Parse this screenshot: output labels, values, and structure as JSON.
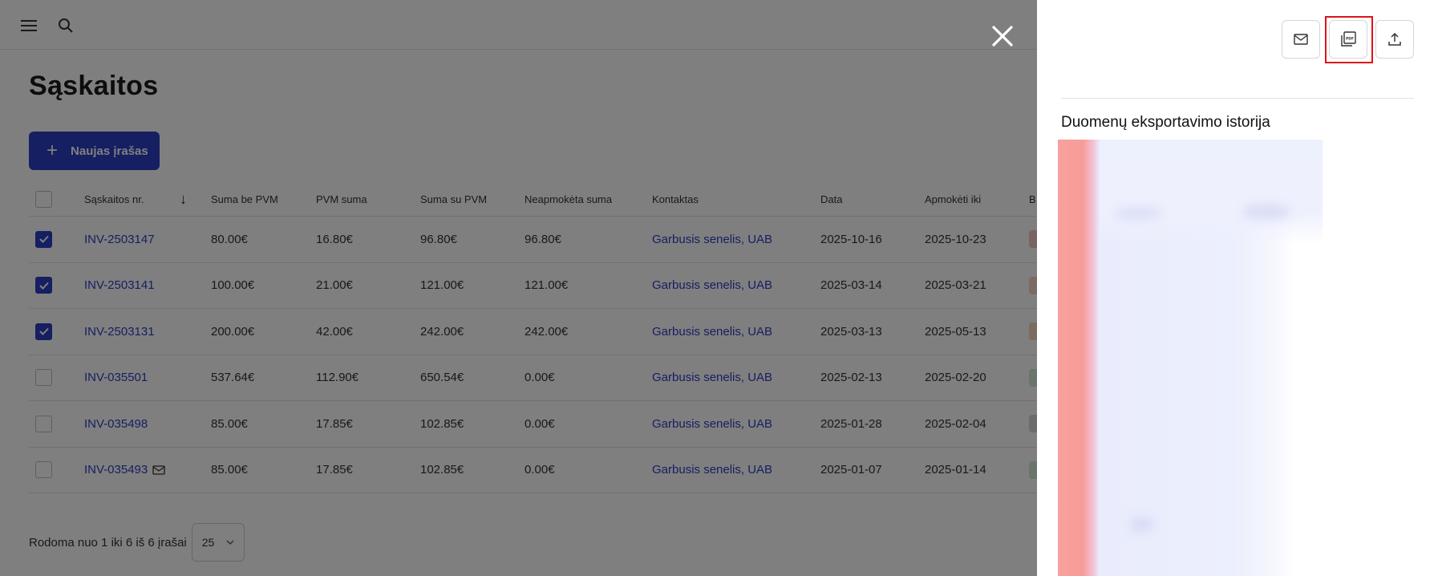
{
  "topbar": {
    "menu_icon": "hamburger-menu-icon",
    "search_icon": "search-icon"
  },
  "page": {
    "title": "Sąskaitos",
    "new_button_label": "Naujas įrašas"
  },
  "table": {
    "columns": {
      "invoice_nr": "Sąskaitos nr.",
      "sum_without_vat": "Suma be PVM",
      "vat_sum": "PVM suma",
      "sum_with_vat": "Suma su PVM",
      "unpaid_sum": "Neapmokėta suma",
      "contact": "Kontaktas",
      "date": "Data",
      "due": "Apmokėti iki",
      "status_partial": "B"
    },
    "rows": [
      {
        "checked": true,
        "nr": "INV-2503147",
        "sbp": "80.00€",
        "pvm": "16.80€",
        "ssp": "96.80€",
        "neap": "96.80€",
        "kontaktas": "Garbusis senelis, UAB",
        "data": "2025-10-16",
        "apm": "2025-10-23",
        "status_color": "#f4c7c7",
        "mail": false
      },
      {
        "checked": true,
        "nr": "INV-2503141",
        "sbp": "100.00€",
        "pvm": "21.00€",
        "ssp": "121.00€",
        "neap": "121.00€",
        "kontaktas": "Garbusis senelis, UAB",
        "data": "2025-03-14",
        "apm": "2025-03-21",
        "status_color": "#f6d7c2",
        "mail": false
      },
      {
        "checked": true,
        "nr": "INV-2503131",
        "sbp": "200.00€",
        "pvm": "42.00€",
        "ssp": "242.00€",
        "neap": "242.00€",
        "kontaktas": "Garbusis senelis, UAB",
        "data": "2025-03-13",
        "apm": "2025-05-13",
        "status_color": "#f6d7c2",
        "mail": false
      },
      {
        "checked": false,
        "nr": "INV-035501",
        "sbp": "537.64€",
        "pvm": "112.90€",
        "ssp": "650.54€",
        "neap": "0.00€",
        "kontaktas": "Garbusis senelis, UAB",
        "data": "2025-02-13",
        "apm": "2025-02-20",
        "status_color": "#cfead6",
        "mail": false
      },
      {
        "checked": false,
        "nr": "INV-035498",
        "sbp": "85.00€",
        "pvm": "17.85€",
        "ssp": "102.85€",
        "neap": "0.00€",
        "kontaktas": "Garbusis senelis, UAB",
        "data": "2025-01-28",
        "apm": "2025-02-04",
        "status_color": "#d9d9d9",
        "mail": false
      },
      {
        "checked": false,
        "nr": "INV-035493",
        "sbp": "85.00€",
        "pvm": "17.85€",
        "ssp": "102.85€",
        "neap": "0.00€",
        "kontaktas": "Garbusis senelis, UAB",
        "data": "2025-01-07",
        "apm": "2025-01-14",
        "status_color": "#cfead6",
        "mail": true
      }
    ]
  },
  "footer": {
    "showing_text": "Rodoma nuo 1 iki 6 iš 6 įrašai",
    "page_size": "25"
  },
  "drawer": {
    "history_title": "Duomenų eksportavimo istorija",
    "buttons": [
      "mail-icon",
      "pdf-icon",
      "upload-icon"
    ]
  },
  "colors": {
    "accent": "#2d3ec5",
    "highlight": "#e0121c",
    "backdrop": "rgba(0,0,0,0.5)"
  }
}
